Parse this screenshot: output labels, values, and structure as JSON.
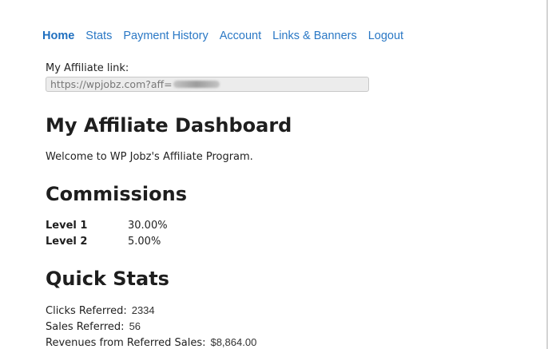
{
  "nav": {
    "items": [
      {
        "label": "Home",
        "active": true
      },
      {
        "label": "Stats",
        "active": false
      },
      {
        "label": "Payment History",
        "active": false
      },
      {
        "label": "Account",
        "active": false
      },
      {
        "label": "Links & Banners",
        "active": false
      },
      {
        "label": "Logout",
        "active": false
      }
    ]
  },
  "affiliate_link": {
    "label": "My Affiliate link:",
    "value": "https://wpjobz.com?aff="
  },
  "dashboard": {
    "title": "My Affiliate Dashboard",
    "welcome": "Welcome to WP Jobz's Affiliate Program."
  },
  "commissions": {
    "title": "Commissions",
    "levels": [
      {
        "name": "Level 1",
        "rate": "30.00%"
      },
      {
        "name": "Level 2",
        "rate": "5.00%"
      }
    ]
  },
  "quick_stats": {
    "title": "Quick Stats",
    "clicks_label": "Clicks Referred:",
    "clicks_value": "2334",
    "sales_label": "Sales Referred:",
    "sales_value": "56",
    "revenue_label": "Revenues from Referred Sales:",
    "revenue_value": "$8,864.00"
  },
  "colors": {
    "link": "#2a78c5",
    "heading": "#1e1e1e"
  }
}
